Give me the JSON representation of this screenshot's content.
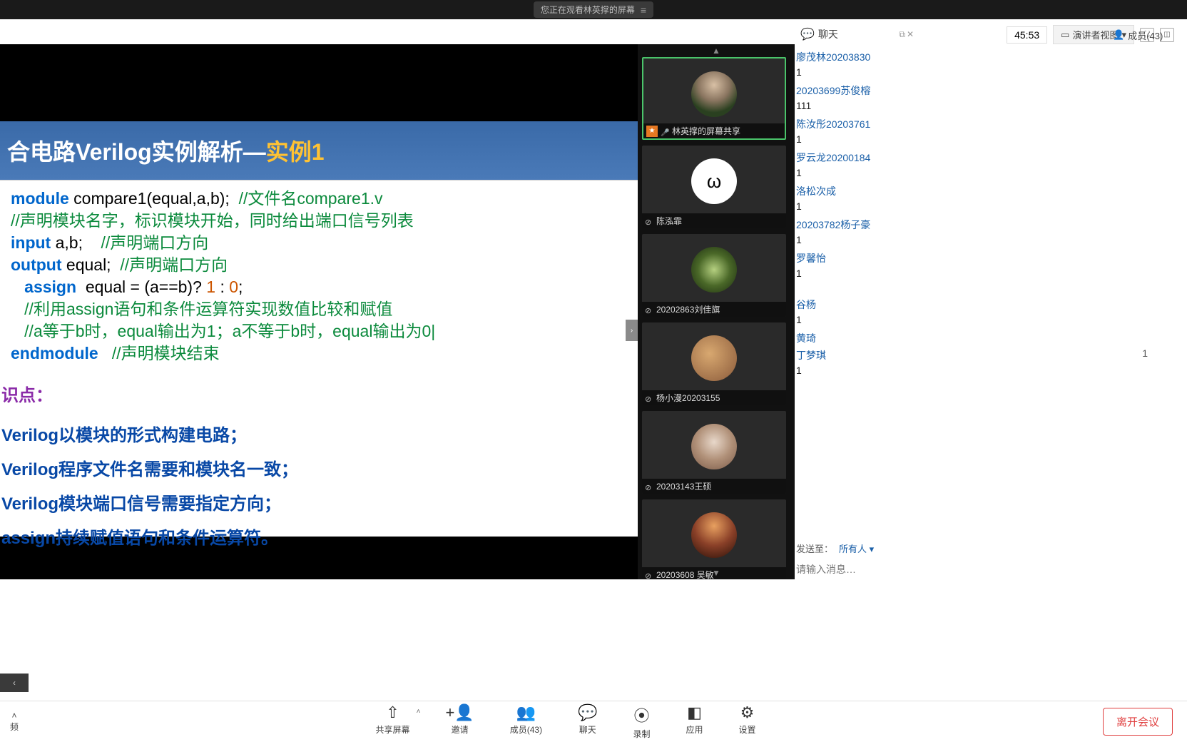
{
  "top": {
    "banner": "您正在观看林英撑的屏幕",
    "menu_icon": "≡"
  },
  "meetingBar": {
    "timer": "45:53",
    "presenterView": "演讲者视图"
  },
  "tabs": {
    "chat": "聊天",
    "members": "成员(43)"
  },
  "slide": {
    "title_pre": "合电路Verilog实例解析—",
    "title_hl": "实例1",
    "code_lines": [
      {
        "segments": [
          {
            "t": "module",
            "c": "kw"
          },
          {
            "t": " compare1(equal,a,b);  ",
            "c": ""
          },
          {
            "t": "//文件名compare1.v",
            "c": "cmt"
          }
        ]
      },
      {
        "segments": [
          {
            "t": "//声明模块名字，标识模块开始，同时给出端口信号列表",
            "c": "cmt"
          }
        ]
      },
      {
        "segments": [
          {
            "t": "input",
            "c": "kw"
          },
          {
            "t": " a,b;    ",
            "c": ""
          },
          {
            "t": "//声明端口方向",
            "c": "cmt"
          }
        ]
      },
      {
        "segments": [
          {
            "t": "output",
            "c": "kw"
          },
          {
            "t": " equal;  ",
            "c": ""
          },
          {
            "t": "//声明端口方向",
            "c": "cmt"
          }
        ]
      },
      {
        "segments": [
          {
            "t": "   assign",
            "c": "kw"
          },
          {
            "t": "  equal = (a==b)? ",
            "c": ""
          },
          {
            "t": "1",
            "c": "num"
          },
          {
            "t": " : ",
            "c": ""
          },
          {
            "t": "0",
            "c": "num"
          },
          {
            "t": ";",
            "c": ""
          }
        ]
      },
      {
        "segments": [
          {
            "t": "   //利用assign语句和条件运算符实现数值比较和赋值",
            "c": "cmt"
          }
        ]
      },
      {
        "segments": [
          {
            "t": "   //a等于b时，equal输出为1；a不等于b时，equal输出为0|",
            "c": "cmt"
          }
        ]
      },
      {
        "segments": [
          {
            "t": "endmodule",
            "c": "kw"
          },
          {
            "t": "   ",
            "c": ""
          },
          {
            "t": "//声明模块结束",
            "c": "cmt"
          }
        ]
      }
    ],
    "points_header": "识点：",
    "points": [
      "Verilog以模块的形式构建电路；",
      "Verilog程序文件名需要和模块名一致；",
      "Verilog模块端口信号需要指定方向；",
      "assign持续赋值语句和条件运算符。"
    ]
  },
  "videoTiles": [
    {
      "name": "林英撑的屏幕共享",
      "host": true,
      "muted": false,
      "avatarClass": "c1"
    },
    {
      "name": "陈泓霏",
      "host": false,
      "muted": true,
      "avatarClass": "c2",
      "face": "ω"
    },
    {
      "name": "20202863刘佳旗",
      "host": false,
      "muted": true,
      "avatarClass": "c3"
    },
    {
      "name": "杨小漫20203155",
      "host": false,
      "muted": true,
      "avatarClass": "c4"
    },
    {
      "name": "20203143王硕",
      "host": false,
      "muted": true,
      "avatarClass": "c5"
    },
    {
      "name": "20203608 吴敏",
      "host": false,
      "muted": true,
      "avatarClass": "c6"
    }
  ],
  "chat": {
    "messages": [
      {
        "name": "廖茂林20203830",
        "text": "1"
      },
      {
        "name": "20203699苏俊榕",
        "text": "111"
      },
      {
        "name": "陈汝彤20203761",
        "text": "1"
      },
      {
        "name": "罗云龙20200184",
        "text": "1"
      },
      {
        "name": "洛松次成",
        "text": "1"
      },
      {
        "name": "20203782杨子豪",
        "text": "1"
      },
      {
        "name": "罗馨怡",
        "text": "1"
      },
      {
        "name": "",
        "text": ""
      },
      {
        "name": "谷杨",
        "text": "1"
      },
      {
        "name": "黄琦",
        "text": "1",
        "right": true,
        "rightText": "1"
      },
      {
        "name": "丁梦琪",
        "text": "1"
      }
    ],
    "sendToLabel": "发送至：",
    "sendToTarget": "所有人 ▾",
    "placeholder": "请输入消息…"
  },
  "bottomBar": {
    "audio": "频",
    "items": [
      {
        "label": "共享屏幕",
        "icon": "⇧"
      },
      {
        "label": "邀请",
        "icon": "+👤"
      },
      {
        "label": "成员(43)",
        "icon": "👥"
      },
      {
        "label": "聊天",
        "icon": "💬"
      },
      {
        "label": "录制",
        "icon": "⦿"
      },
      {
        "label": "应用",
        "icon": "◧"
      },
      {
        "label": "设置",
        "icon": "⚙"
      }
    ],
    "leave": "离开会议"
  }
}
